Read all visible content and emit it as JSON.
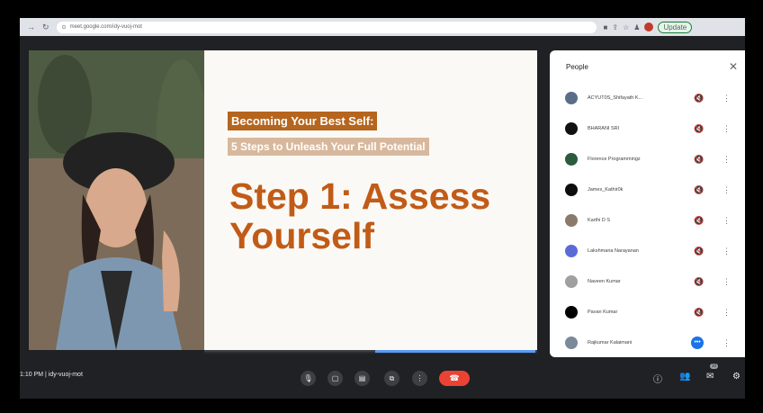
{
  "browser": {
    "url": "meet.google.com/idy-vuoj-mot",
    "update_label": "Update"
  },
  "slide": {
    "line1": "Becoming Your Best Self:",
    "line2": "5 Steps to Unleash Your Full Potential",
    "title": "Step 1: Assess Yourself"
  },
  "people": {
    "title": "People",
    "participants": [
      {
        "name": "ACYUT0S_Shifayath K...",
        "status": "muted",
        "avatar_color": "#5a6e8a"
      },
      {
        "name": "BHARANI SRI",
        "status": "muted",
        "avatar_color": "#111111"
      },
      {
        "name": "Florence Programmingz",
        "status": "muted",
        "avatar_color": "#2d5a3c"
      },
      {
        "name": "James_Kathir0k",
        "status": "muted",
        "avatar_color": "#0d0d0d"
      },
      {
        "name": "Karthi D S",
        "status": "muted",
        "avatar_color": "#8a7a6a"
      },
      {
        "name": "Lakshmana Narayanan",
        "status": "muted",
        "avatar_color": "#5b6bd6"
      },
      {
        "name": "Naveen Kumar",
        "status": "muted",
        "avatar_color": "#a0a0a0"
      },
      {
        "name": "Pavan Kumar",
        "status": "muted",
        "avatar_color": "#000000"
      },
      {
        "name": "Rajkumar Kalaimani",
        "status": "speaking",
        "avatar_color": "#7a8a9a"
      }
    ]
  },
  "controls": {
    "meeting_info": "1:10 PM  |  idy-vuoj-mot",
    "people_count": "10"
  },
  "colors": {
    "accent_orange": "#c15b17",
    "leave_red": "#ea4335",
    "speaking_blue": "#1a73e8"
  }
}
